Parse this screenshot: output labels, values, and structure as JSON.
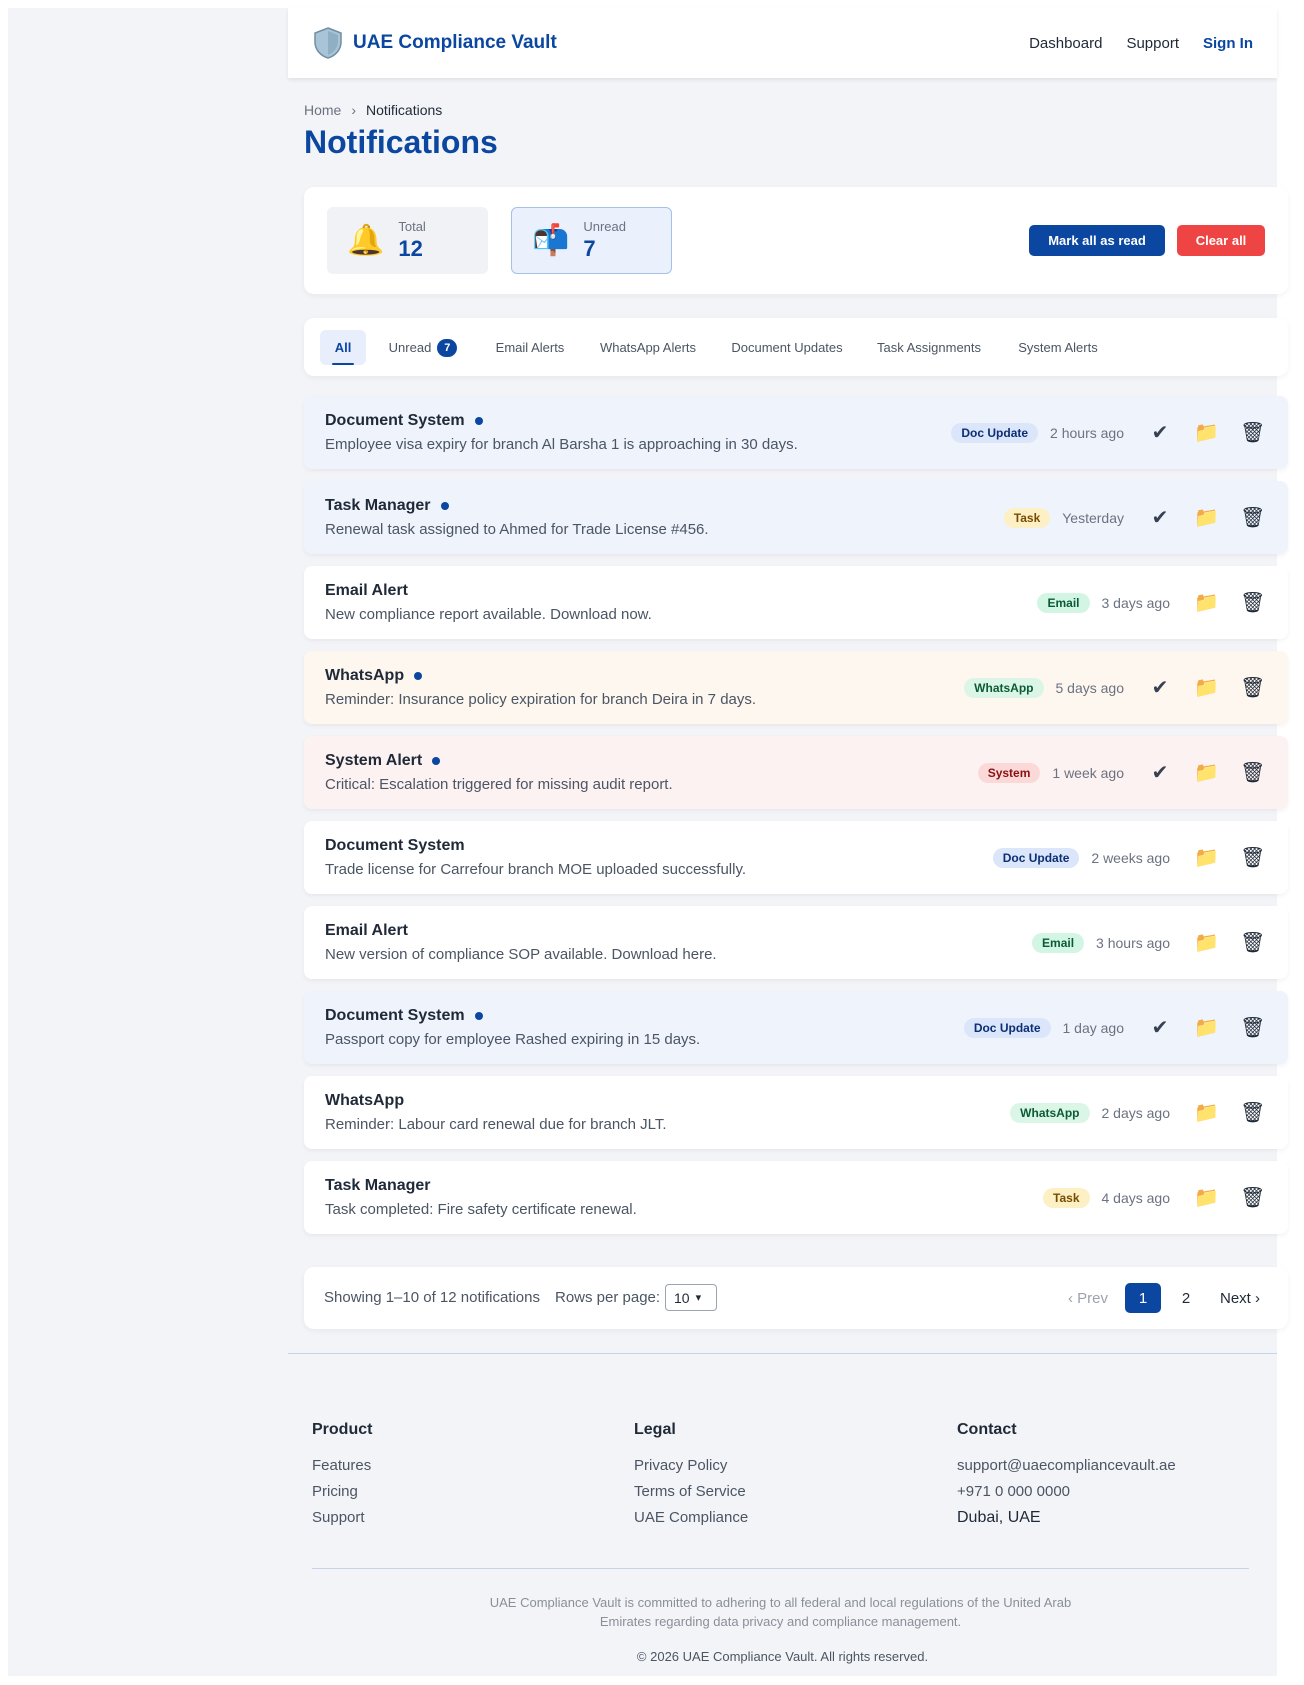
{
  "app": {
    "brand_name": "UAE Compliance Vault",
    "brand_icon": "shield-icon"
  },
  "nav": {
    "dashboard": "Dashboard",
    "support": "Support",
    "sign_in": "Sign In"
  },
  "breadcrumb": {
    "home": "Home",
    "separator": "›",
    "current": "Notifications"
  },
  "page_title": "Notifications",
  "stats": {
    "total": {
      "icon": "bell-icon",
      "emoji": "🔔",
      "label": "Total",
      "value": "12"
    },
    "unread": {
      "icon": "mailbox-icon",
      "emoji": "📬",
      "label": "Unread",
      "value": "7"
    }
  },
  "actions": {
    "mark_all_read": "Mark all as read",
    "clear_all": "Clear all"
  },
  "tabs": [
    {
      "label": "All",
      "active": true
    },
    {
      "label": "Unread",
      "badge": "7"
    },
    {
      "label": "Email Alerts"
    },
    {
      "label": "WhatsApp Alerts"
    },
    {
      "label": "Document Updates"
    },
    {
      "label": "Task Assignments"
    },
    {
      "label": "System Alerts"
    }
  ],
  "notifications": [
    {
      "title": "Document System",
      "unread": true,
      "message": "Employee visa expiry for branch Al Barsha 1 is approaching in 30 days.",
      "tag": "Doc Update",
      "time": "2 hours ago"
    },
    {
      "title": "Task Manager",
      "unread": true,
      "message": "Renewal task assigned to Ahmed for Trade License #456.",
      "tag": "Task",
      "time": "Yesterday"
    },
    {
      "title": "Email Alert",
      "unread": false,
      "message": "New compliance report available. Download now.",
      "tag": "Email",
      "time": "3 days ago"
    },
    {
      "title": "WhatsApp",
      "unread": true,
      "message": "Reminder: Insurance policy expiration for branch Deira in 7 days.",
      "tag": "WhatsApp",
      "time": "5 days ago"
    },
    {
      "title": "System Alert",
      "unread": true,
      "message": "Critical: Escalation triggered for missing audit report.",
      "tag": "System",
      "time": "1 week ago"
    },
    {
      "title": "Document System",
      "unread": false,
      "message": "Trade license for Carrefour branch MOE uploaded successfully.",
      "tag": "Doc Update",
      "time": "2 weeks ago"
    },
    {
      "title": "Email Alert",
      "unread": false,
      "message": "New version of compliance SOP available. Download here.",
      "tag": "Email",
      "time": "3 hours ago"
    },
    {
      "title": "Document System",
      "unread": true,
      "message": "Passport copy for employee Rashed expiring in 15 days.",
      "tag": "Doc Update",
      "time": "1 day ago"
    },
    {
      "title": "WhatsApp",
      "unread": false,
      "message": "Reminder: Labour card renewal due for branch JLT.",
      "tag": "WhatsApp",
      "time": "2 days ago"
    },
    {
      "title": "Task Manager",
      "unread": false,
      "message": "Task completed: Fire safety certificate renewal.",
      "tag": "Task",
      "time": "4 days ago"
    }
  ],
  "row_icons": {
    "mark_read": "check-icon",
    "archive": "folder-icon",
    "delete": "trash-icon"
  },
  "pagination": {
    "info": "Showing 1–10 of 12 notifications",
    "rows_label": "Rows per page:",
    "rows_value": "10",
    "prev": "‹ Prev",
    "page1": "1",
    "page2": "2",
    "next": "Next ›"
  },
  "footer": {
    "product": {
      "heading": "Product",
      "items": [
        "Features",
        "Pricing",
        "Support"
      ]
    },
    "legal": {
      "heading": "Legal",
      "items": [
        "Privacy Policy",
        "Terms of Service",
        "UAE Compliance"
      ]
    },
    "contact": {
      "heading": "Contact",
      "items": [
        "support@uaecompliancevault.ae",
        "+971 0 000 0000",
        "Dubai, UAE"
      ]
    },
    "note": "UAE Compliance Vault is committed to adhering to all federal and local regulations of the United Arab Emirates regarding data privacy and compliance management.",
    "copyright": "© 2026 UAE Compliance Vault. All rights reserved."
  },
  "colors": {
    "primary": "#0b47a1",
    "danger": "#ef4444",
    "page_bg": "#f3f4f8"
  }
}
